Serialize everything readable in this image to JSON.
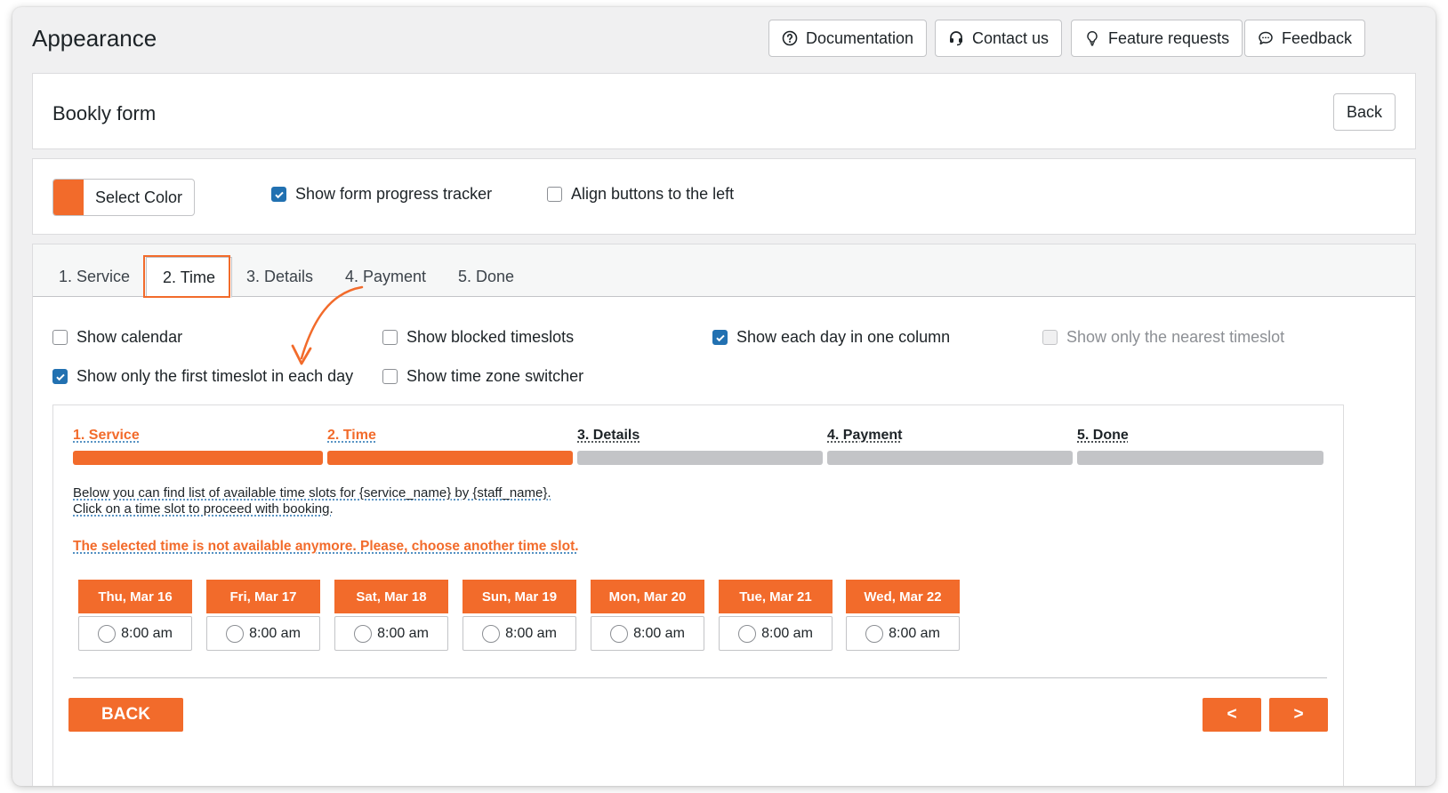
{
  "header": {
    "title": "Appearance",
    "buttons": {
      "documentation": "Documentation",
      "contact": "Contact us",
      "feature_requests": "Feature requests",
      "feedback": "Feedback"
    }
  },
  "form_card": {
    "title": "Bookly form",
    "back_label": "Back"
  },
  "settings": {
    "select_color_label": "Select Color",
    "color": "#f26b2b",
    "show_progress_tracker": {
      "label": "Show form progress tracker",
      "checked": true
    },
    "align_buttons_left": {
      "label": "Align buttons to the left",
      "checked": false
    }
  },
  "tabs": [
    {
      "label": "1. Service"
    },
    {
      "label": "2. Time",
      "active": true
    },
    {
      "label": "3. Details"
    },
    {
      "label": "4. Payment"
    },
    {
      "label": "5. Done"
    }
  ],
  "time_options": {
    "show_calendar": {
      "label": "Show calendar",
      "checked": false
    },
    "show_blocked": {
      "label": "Show blocked timeslots",
      "checked": false
    },
    "show_each_day_column": {
      "label": "Show each day in one column",
      "checked": true
    },
    "show_nearest": {
      "label": "Show only the nearest timeslot",
      "checked": false,
      "disabled": true
    },
    "show_first_slot": {
      "label": "Show only the first timeslot in each day",
      "checked": true
    },
    "show_tz_switcher": {
      "label": "Show time zone switcher",
      "checked": false
    }
  },
  "preview": {
    "steps": [
      {
        "label": "1. Service",
        "state": "done"
      },
      {
        "label": "2. Time",
        "state": "done"
      },
      {
        "label": "3. Details",
        "state": "todo"
      },
      {
        "label": "4. Payment",
        "state": "todo"
      },
      {
        "label": "5. Done",
        "state": "todo"
      }
    ],
    "info_line1": "Below you can find list of available time slots for {service_name} by {staff_name}.",
    "info_line2": "Click on a time slot to proceed with booking.",
    "error": "The selected time is not available anymore. Please, choose another time slot.",
    "days": [
      {
        "label": "Thu, Mar 16",
        "slot": "8:00 am"
      },
      {
        "label": "Fri, Mar 17",
        "slot": "8:00 am"
      },
      {
        "label": "Sat, Mar 18",
        "slot": "8:00 am"
      },
      {
        "label": "Sun, Mar 19",
        "slot": "8:00 am"
      },
      {
        "label": "Mon, Mar 20",
        "slot": "8:00 am"
      },
      {
        "label": "Tue, Mar 21",
        "slot": "8:00 am"
      },
      {
        "label": "Wed, Mar 22",
        "slot": "8:00 am"
      }
    ],
    "back_label": "BACK",
    "prev_label": "<",
    "next_label": ">"
  },
  "colors": {
    "accent": "#f26b2b",
    "checkbox": "#2271b1",
    "progress_todo": "#c3c4c7"
  }
}
